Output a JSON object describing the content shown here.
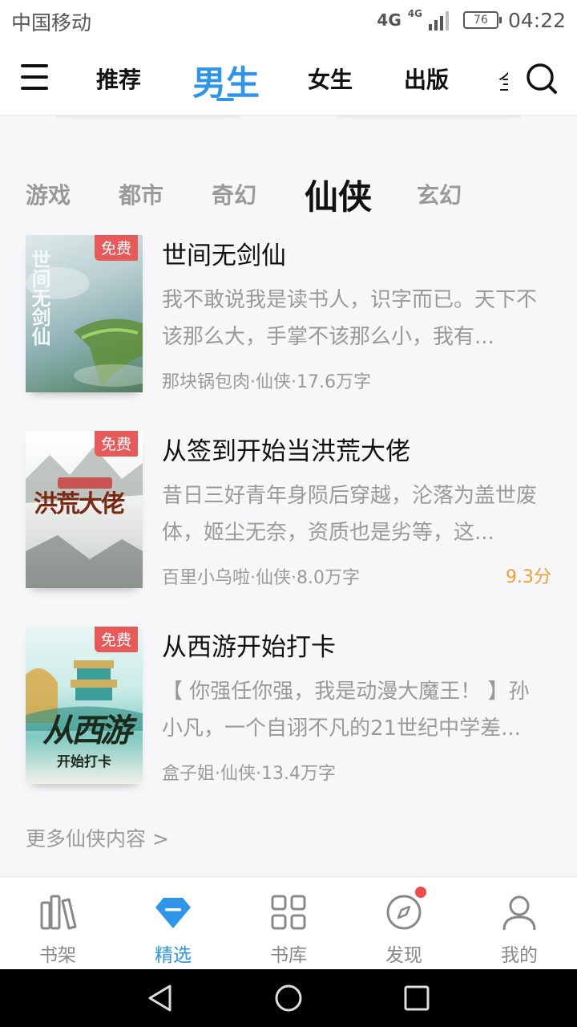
{
  "status": {
    "carrier": "中国移动",
    "network": "4G",
    "network2": "4G",
    "battery": "76",
    "time": "04:22"
  },
  "top_tabs": [
    "推荐",
    "男生",
    "女生",
    "出版"
  ],
  "active_top_tab": "男生",
  "categories": [
    "游戏",
    "都市",
    "奇幻",
    "仙侠",
    "玄幻"
  ],
  "active_category": "仙侠",
  "books": [
    {
      "badge": "免费",
      "title": "世间无剑仙",
      "description": "我不敢说我是读书人，识字而已。天下不该那么大，手掌不该那么小，我有...",
      "meta": "那块锅包肉·仙侠·17.6万字",
      "score": "",
      "cover_text": "世间无剑仙"
    },
    {
      "badge": "免费",
      "title": "从签到开始当洪荒大佬",
      "description": "昔日三好青年身陨后穿越，沦落为盖世废体，姬尘无奈，资质也是劣等，这...",
      "meta": "百里小乌啦·仙侠·8.0万字",
      "score": "9.3分",
      "cover_text": "洪荒大佬"
    },
    {
      "badge": "免费",
      "title": "从西游开始打卡",
      "description": "【 你强任你强，我是动漫大魔王！ 】孙小凡，一个自诩不凡的21世纪中学差...",
      "meta": "盒子姐·仙侠·13.4万字",
      "score": "",
      "cover_text": "从西游",
      "cover_subtext": "开始打卡"
    }
  ],
  "more_link": "更多仙侠内容 >",
  "bottom_nav": [
    {
      "label": "书架",
      "icon": "bookshelf-icon"
    },
    {
      "label": "精选",
      "icon": "diamond-icon"
    },
    {
      "label": "书库",
      "icon": "grid-icon"
    },
    {
      "label": "发现",
      "icon": "compass-icon"
    },
    {
      "label": "我的",
      "icon": "user-icon"
    }
  ],
  "active_bottom": "精选",
  "colors": {
    "accent": "#2e95e8",
    "badge": "#e85a5a",
    "score": "#f0a030",
    "notification": "#f04a4a"
  }
}
